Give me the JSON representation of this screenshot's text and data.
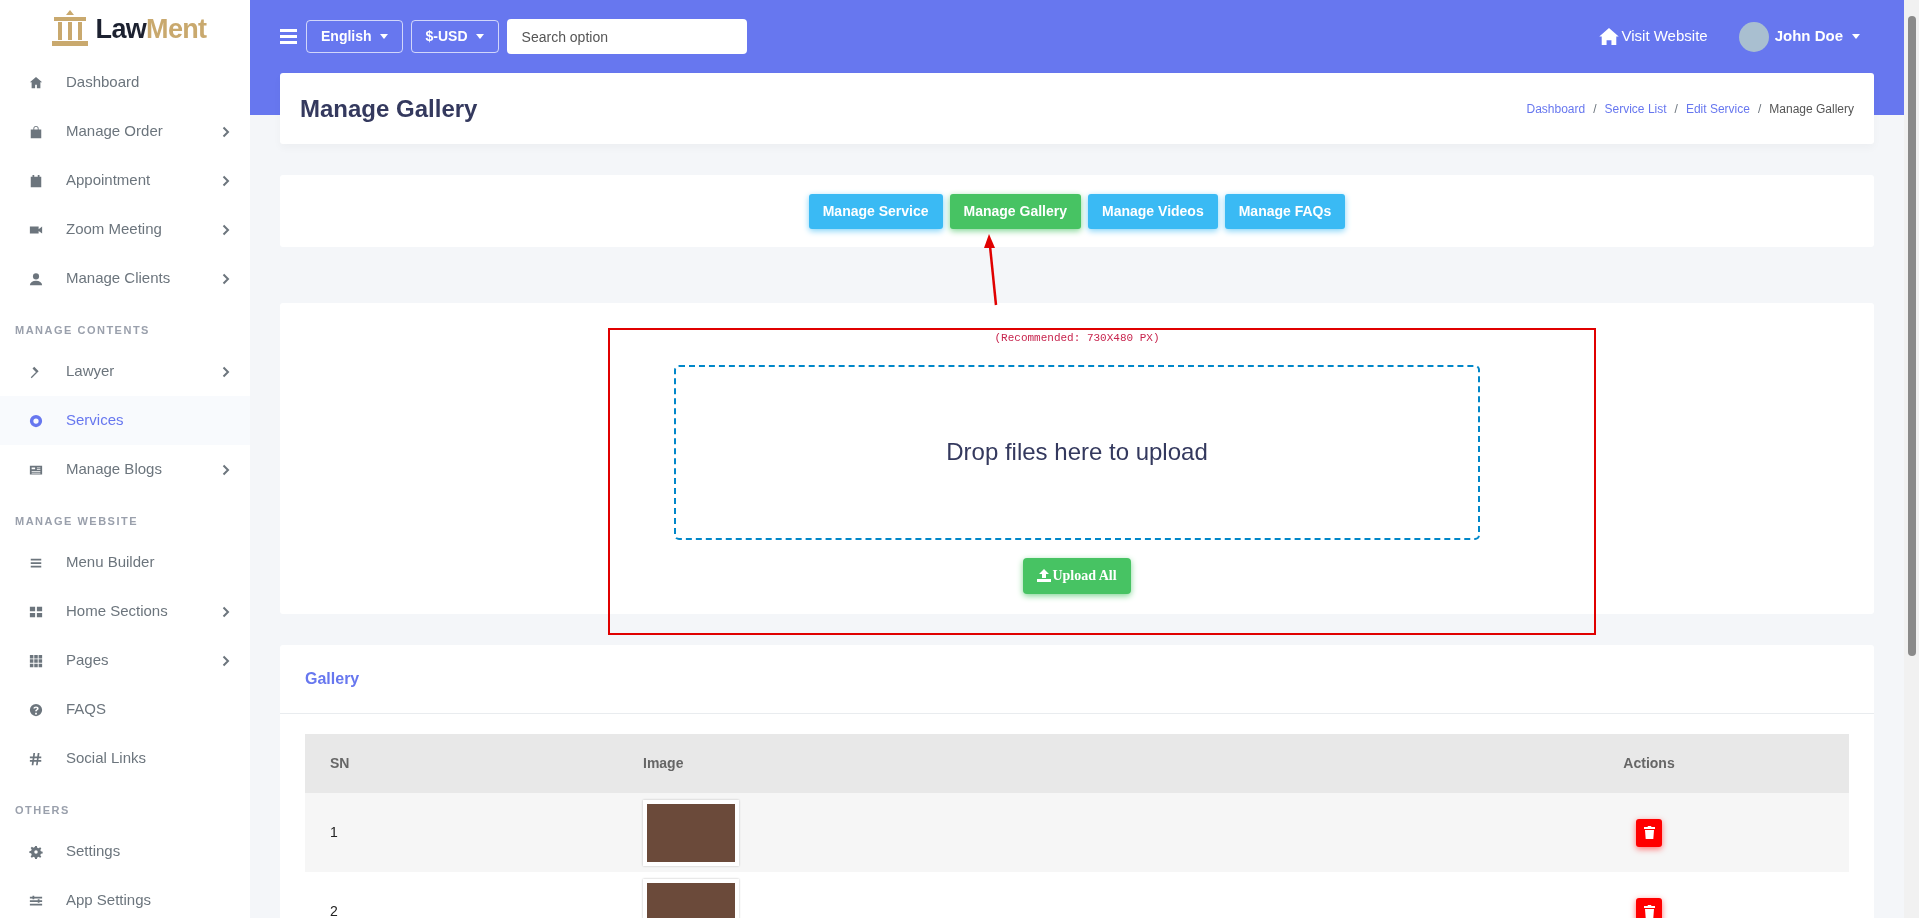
{
  "logo": {
    "first_part": "Law",
    "second_part": "Ment"
  },
  "sidebar": {
    "sections": [
      {
        "items": [
          {
            "label": "Dashboard",
            "has_submenu": false,
            "selected": false
          },
          {
            "label": "Manage Order",
            "has_submenu": true,
            "selected": false
          },
          {
            "label": "Appointment",
            "has_submenu": true,
            "selected": false
          },
          {
            "label": "Zoom Meeting",
            "has_submenu": true,
            "selected": false
          },
          {
            "label": "Manage Clients",
            "has_submenu": true,
            "selected": false
          }
        ]
      },
      {
        "heading": "MANAGE CONTENTS",
        "items": [
          {
            "label": "Lawyer",
            "has_submenu": true,
            "selected": false
          },
          {
            "label": "Services",
            "has_submenu": false,
            "selected": true
          },
          {
            "label": "Manage Blogs",
            "has_submenu": true,
            "selected": false
          }
        ]
      },
      {
        "heading": "MANAGE WEBSITE",
        "items": [
          {
            "label": "Menu Builder",
            "has_submenu": false,
            "selected": false
          },
          {
            "label": "Home Sections",
            "has_submenu": true,
            "selected": false
          },
          {
            "label": "Pages",
            "has_submenu": true,
            "selected": false
          },
          {
            "label": "FAQS",
            "has_submenu": false,
            "selected": false
          },
          {
            "label": "Social Links",
            "has_submenu": false,
            "selected": false
          }
        ]
      },
      {
        "heading": "OTHERS",
        "items": [
          {
            "label": "Settings",
            "has_submenu": false,
            "selected": false
          },
          {
            "label": "App Settings",
            "has_submenu": false,
            "selected": false
          }
        ]
      }
    ]
  },
  "topbar": {
    "language": "English",
    "currency": "$-USD",
    "search": {
      "placeholder": "Search option"
    },
    "visit_website": "Visit Website",
    "user_name": "John Doe"
  },
  "page_header": {
    "title": "Manage Gallery",
    "separator": "/",
    "breadcrumb": [
      {
        "label": "Dashboard",
        "link": true
      },
      {
        "label": "Service List",
        "link": true
      },
      {
        "label": "Edit Service",
        "link": true
      },
      {
        "label": "Manage Gallery",
        "link": false
      }
    ]
  },
  "tabs": [
    {
      "label": "Manage Service",
      "selected": false
    },
    {
      "label": "Manage Gallery",
      "selected": true
    },
    {
      "label": "Manage Videos",
      "selected": false
    },
    {
      "label": "Manage FAQs",
      "selected": false
    }
  ],
  "upload": {
    "hint": "(Recommended: 730X480 PX)",
    "dropzone_text": "Drop files here to upload",
    "button": "Upload All"
  },
  "gallery": {
    "title": "Gallery",
    "table": {
      "columns": [
        "SN",
        "Image",
        "Actions"
      ],
      "rows": [
        {
          "sn": "1"
        },
        {
          "sn": "2"
        }
      ]
    }
  }
}
